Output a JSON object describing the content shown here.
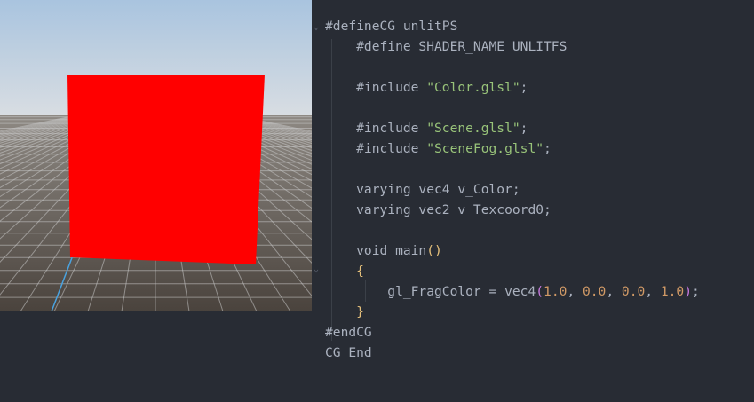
{
  "viewport": {
    "sky_top_color": "#a9c4df",
    "ground_color": "#524b45",
    "grid_color": "#c8c8c8",
    "axis_color": "#4aa3e0",
    "cube_color": "#ff0000"
  },
  "editor": {
    "lines": [
      {
        "segments": [
          {
            "t": "#defineCG unlitPS",
            "c": "kw"
          }
        ]
      },
      {
        "segments": [
          {
            "t": "    #define SHADER_NAME UNLITFS",
            "c": "kw"
          }
        ]
      },
      {
        "segments": [
          {
            "t": "",
            "c": "kw"
          }
        ]
      },
      {
        "segments": [
          {
            "t": "    #include ",
            "c": "kw"
          },
          {
            "t": "\"Color.glsl\"",
            "c": "str"
          },
          {
            "t": ";",
            "c": "kw"
          }
        ]
      },
      {
        "segments": [
          {
            "t": "",
            "c": "kw"
          }
        ]
      },
      {
        "segments": [
          {
            "t": "    #include ",
            "c": "kw"
          },
          {
            "t": "\"Scene.glsl\"",
            "c": "str"
          },
          {
            "t": ";",
            "c": "kw"
          }
        ]
      },
      {
        "segments": [
          {
            "t": "    #include ",
            "c": "kw"
          },
          {
            "t": "\"SceneFog.glsl\"",
            "c": "str"
          },
          {
            "t": ";",
            "c": "kw"
          }
        ]
      },
      {
        "segments": [
          {
            "t": "",
            "c": "kw"
          }
        ]
      },
      {
        "segments": [
          {
            "t": "    varying vec4 v_Color;",
            "c": "kw"
          }
        ]
      },
      {
        "segments": [
          {
            "t": "    varying vec2 v_Texcoord0;",
            "c": "kw"
          }
        ]
      },
      {
        "segments": [
          {
            "t": "",
            "c": "kw"
          }
        ]
      },
      {
        "segments": [
          {
            "t": "    void main",
            "c": "kw"
          },
          {
            "t": "()",
            "c": "brace"
          }
        ]
      },
      {
        "segments": [
          {
            "t": "    ",
            "c": "kw"
          },
          {
            "t": "{",
            "c": "brace"
          }
        ]
      },
      {
        "segments": [
          {
            "t": "        gl_FragColor = vec4",
            "c": "kw"
          },
          {
            "t": "(",
            "c": "str2"
          },
          {
            "t": "1.0",
            "c": "num"
          },
          {
            "t": ", ",
            "c": "kw"
          },
          {
            "t": "0.0",
            "c": "num"
          },
          {
            "t": ", ",
            "c": "kw"
          },
          {
            "t": "0.0",
            "c": "num"
          },
          {
            "t": ", ",
            "c": "kw"
          },
          {
            "t": "1.0",
            "c": "num"
          },
          {
            "t": ")",
            "c": "str2"
          },
          {
            "t": ";",
            "c": "kw"
          }
        ]
      },
      {
        "segments": [
          {
            "t": "    ",
            "c": "kw"
          },
          {
            "t": "}",
            "c": "brace"
          }
        ]
      },
      {
        "segments": [
          {
            "t": "#endCG",
            "c": "kw"
          }
        ]
      },
      {
        "segments": [
          {
            "t": "CG End",
            "c": "kw"
          }
        ]
      }
    ]
  }
}
